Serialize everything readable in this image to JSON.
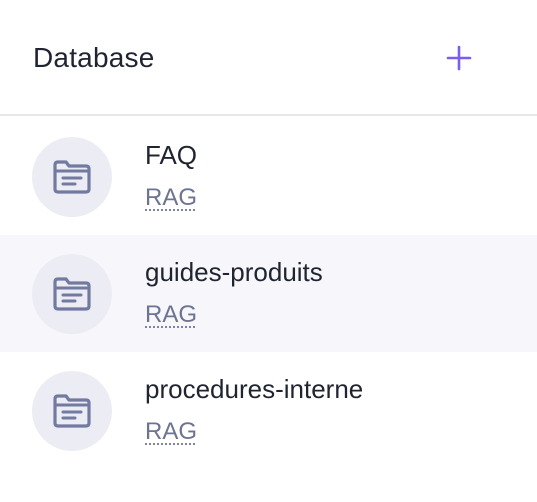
{
  "header": {
    "title": "Database",
    "add_icon": "plus-icon"
  },
  "colors": {
    "accent": "#7c5cf2",
    "selected_row": "#f6f6fb",
    "avatar_bg": "#ececf5",
    "icon": "#727aa0"
  },
  "items": [
    {
      "name": "FAQ",
      "type": "RAG",
      "icon": "folder-icon",
      "selected": false
    },
    {
      "name": "guides-produits",
      "type": "RAG",
      "icon": "folder-icon",
      "selected": true
    },
    {
      "name": "procedures-interne",
      "type": "RAG",
      "icon": "folder-icon",
      "selected": false
    }
  ]
}
